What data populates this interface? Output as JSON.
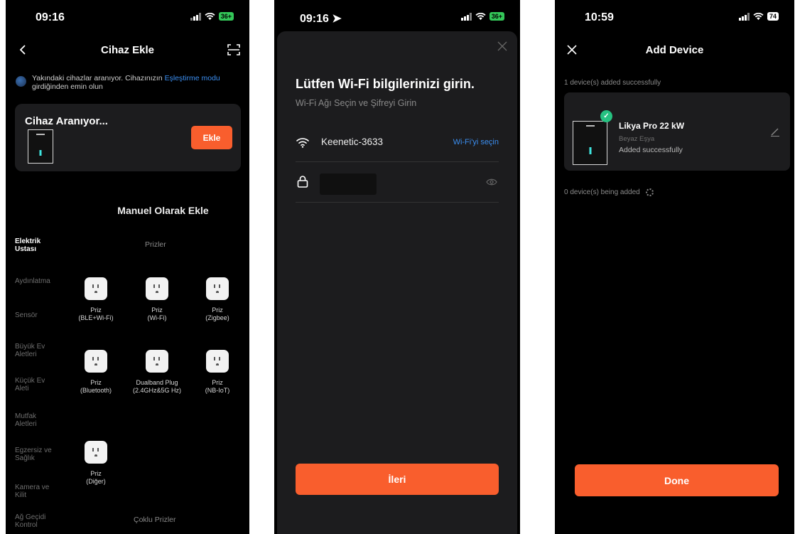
{
  "screen1": {
    "status": {
      "time": "09:16",
      "battery": "36+"
    },
    "nav_title": "Cihaz Ekle",
    "info_text": "Yakındaki cihazlar aranıyor. Cihazınızın ",
    "info_link": "Eşleştirme modu",
    "info_text2": " girdiğinden emin olun",
    "search_title": "Cihaz Aranıyor...",
    "add_button": "Ekle",
    "manual_title": "Manuel Olarak Ekle",
    "categories": [
      "Elektrik Ustası",
      "Aydınlatma",
      "Sensör",
      "Büyük Ev Aletleri",
      "Küçük Ev Aleti",
      "Mutfak Aletleri",
      "Egzersiz ve Sağlık",
      "Kamera ve Kilit",
      "Ağ Geçidi Kontrol"
    ],
    "section_prizler": "Prizler",
    "section_coklu": "Çoklu Prizler",
    "items": [
      "Priz\n(BLE+Wi-Fi)",
      "Priz\n(Wi-Fi)",
      "Priz\n(Zigbee)",
      "Priz\n(Bluetooth)",
      "Dualband Plug\n(2.4GHz&5G Hz)",
      "Priz\n(NB-IoT)",
      "Priz\n(Diğer)"
    ]
  },
  "screen2": {
    "status": {
      "time": "09:16",
      "battery": "36+"
    },
    "title": "Lütfen Wi-Fi bilgilerinizi girin.",
    "subtitle": "Wi-Fi Ağı Seçin ve Şifreyi Girin",
    "ssid": "Keenetic-3633",
    "choose_wifi": "Wi-Fi'yi seçin",
    "next_button": "İleri"
  },
  "screen3": {
    "status": {
      "time": "10:59",
      "battery": "74"
    },
    "title": "Add Device",
    "added_note": "1 device(s) added successfully",
    "device_name": "Likya Pro 22 kW",
    "device_category": "Beyaz Eşya",
    "device_status": "Added successfully",
    "being_added": "0 device(s) being added",
    "done_button": "Done"
  },
  "colors": {
    "accent": "#f95e2d",
    "link": "#3b8ef0",
    "success": "#26c281"
  }
}
